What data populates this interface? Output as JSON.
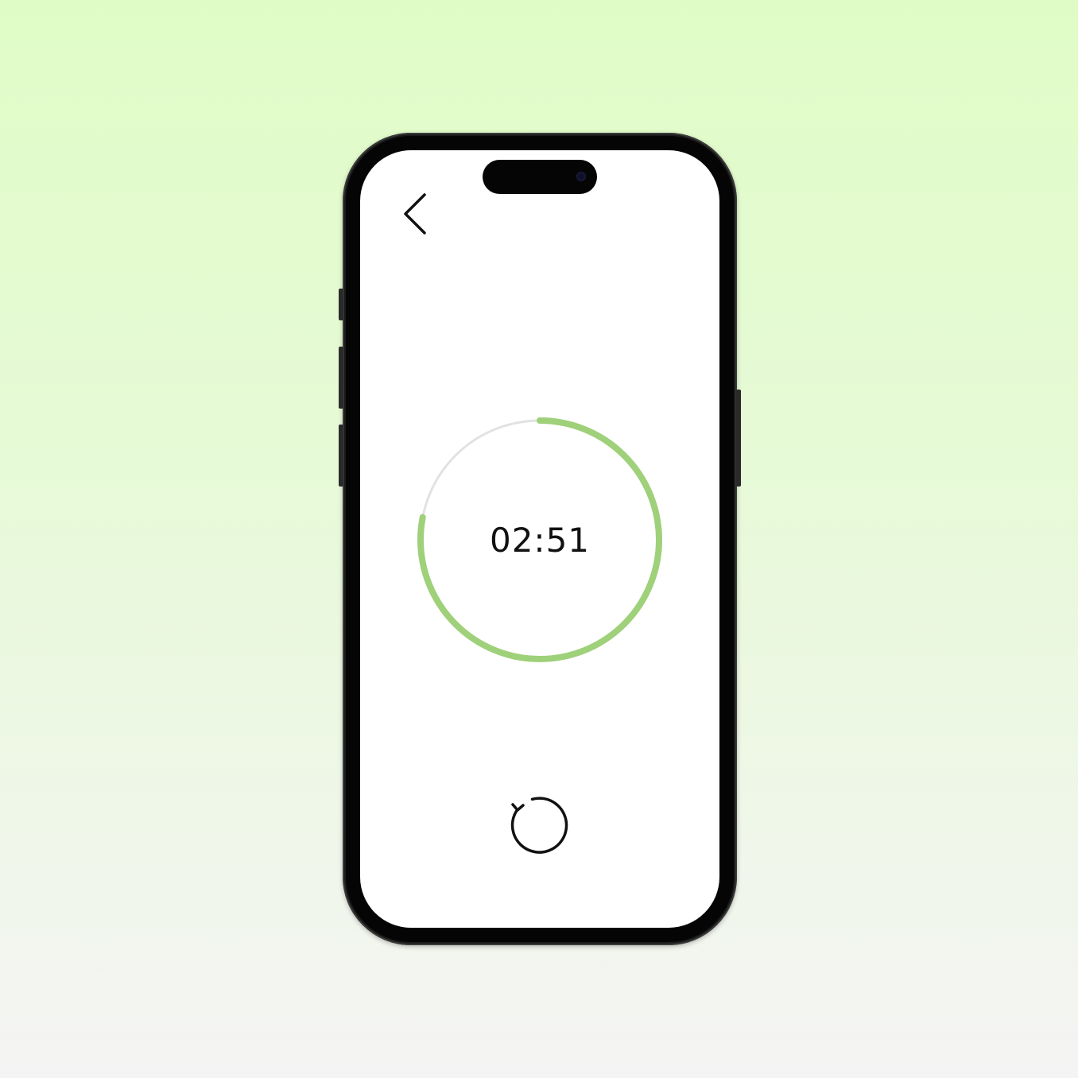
{
  "timer": {
    "time_display": "02:51",
    "progress_fraction": 0.78,
    "progress_color": "#9fd07a",
    "track_color": "#e2e2e2"
  },
  "icons": {
    "back": "chevron-left-icon",
    "reset": "refresh-icon"
  },
  "colors": {
    "background_top": "#e0fcc6",
    "background_bottom": "#f4f4f4",
    "text": "#111111"
  }
}
